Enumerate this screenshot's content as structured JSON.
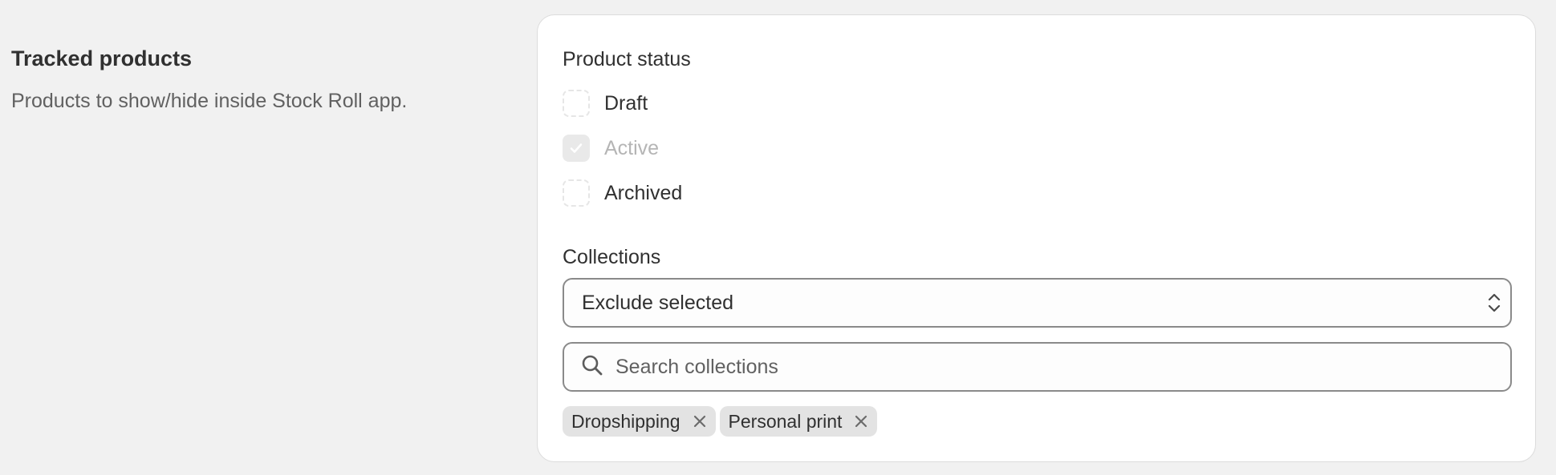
{
  "section": {
    "title": "Tracked products",
    "description": "Products to show/hide inside Stock Roll app."
  },
  "product_status": {
    "label": "Product status",
    "options": [
      {
        "label": "Draft",
        "checked": false,
        "disabled": false
      },
      {
        "label": "Active",
        "checked": true,
        "disabled": true
      },
      {
        "label": "Archived",
        "checked": false,
        "disabled": false
      }
    ]
  },
  "collections": {
    "label": "Collections",
    "mode_value": "Exclude selected",
    "search_placeholder": "Search collections",
    "tags": [
      "Dropshipping",
      "Personal print"
    ]
  },
  "icons": {
    "search": "search-icon",
    "select": "select-arrows-icon",
    "remove": "close-icon",
    "check": "checkmark-icon"
  }
}
